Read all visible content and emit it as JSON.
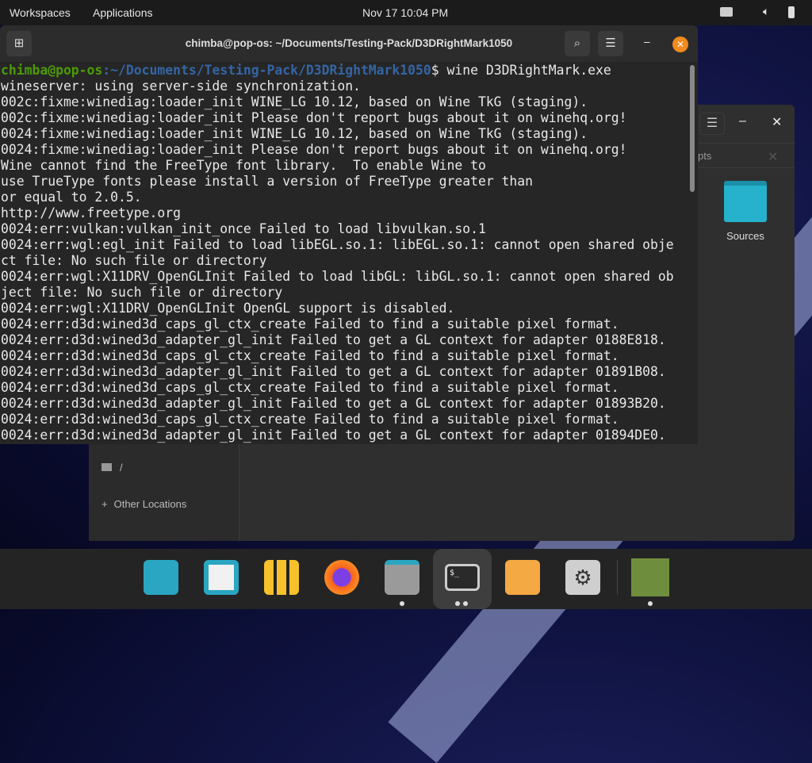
{
  "topbar": {
    "workspaces": "Workspaces",
    "applications": "Applications",
    "clock": "Nov 17  10:04 PM"
  },
  "files": {
    "tab_partial": "pts",
    "folder": "Sources",
    "sidebar": [
      {
        "label": "/"
      },
      {
        "label": "Other Locations"
      }
    ]
  },
  "terminal": {
    "title": "chimba@pop-os: ~/Documents/Testing-Pack/D3DRightMark1050",
    "prompt_user": "chimba@pop-os",
    "prompt_path": ":~/Documents/Testing-Pack/D3DRightMark1050",
    "command": "$ wine D3DRightMark.exe",
    "lines": [
      "wineserver: using server-side synchronization.",
      "002c:fixme:winediag:loader_init WINE_LG 10.12, based on Wine TkG (staging).",
      "002c:fixme:winediag:loader_init Please don't report bugs about it on winehq.org!",
      "0024:fixme:winediag:loader_init WINE_LG 10.12, based on Wine TkG (staging).",
      "0024:fixme:winediag:loader_init Please don't report bugs about it on winehq.org!",
      "Wine cannot find the FreeType font library.  To enable Wine to",
      "use TrueType fonts please install a version of FreeType greater than",
      "or equal to 2.0.5.",
      "http://www.freetype.org",
      "0024:err:vulkan:vulkan_init_once Failed to load libvulkan.so.1",
      "0024:err:wgl:egl_init Failed to load libEGL.so.1: libEGL.so.1: cannot open shared obje",
      "ct file: No such file or directory",
      "0024:err:wgl:X11DRV_OpenGLInit Failed to load libGL: libGL.so.1: cannot open shared ob",
      "ject file: No such file or directory",
      "0024:err:wgl:X11DRV_OpenGLInit OpenGL support is disabled.",
      "0024:err:d3d:wined3d_caps_gl_ctx_create Failed to find a suitable pixel format.",
      "0024:err:d3d:wined3d_adapter_gl_init Failed to get a GL context for adapter 0188E818.",
      "0024:err:d3d:wined3d_caps_gl_ctx_create Failed to find a suitable pixel format.",
      "0024:err:d3d:wined3d_adapter_gl_init Failed to get a GL context for adapter 01891B08.",
      "0024:err:d3d:wined3d_caps_gl_ctx_create Failed to find a suitable pixel format.",
      "0024:err:d3d:wined3d_adapter_gl_init Failed to get a GL context for adapter 01893B20.",
      "0024:err:d3d:wined3d_caps_gl_ctx_create Failed to find a suitable pixel format.",
      "0024:err:d3d:wined3d_adapter_gl_init Failed to get a GL context for adapter 01894DE0."
    ]
  },
  "dock": [
    "search",
    "window-tiling",
    "app-library",
    "firefox",
    "files",
    "terminal",
    "launcher",
    "settings",
    "system-monitor"
  ],
  "colors": {
    "prompt_user": "#4e9a06",
    "prompt_path": "#3465a4",
    "close": "#f28a1d",
    "folder": "#26b1cc"
  }
}
